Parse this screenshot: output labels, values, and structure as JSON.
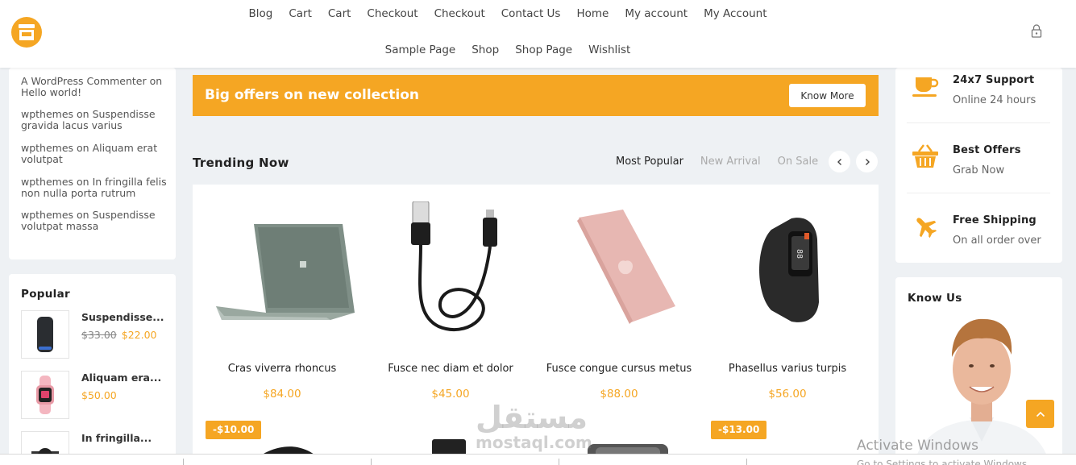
{
  "header": {
    "logo": "store-icon",
    "nav_row1": [
      "Blog",
      "Cart",
      "Cart",
      "Checkout",
      "Checkout",
      "Contact Us",
      "Home",
      "My account",
      "My Account"
    ],
    "nav_row2": [
      "Sample Page",
      "Shop",
      "Shop Page",
      "Wishlist"
    ],
    "lock_icon": "lock-icon"
  },
  "sidebar_left": {
    "comments": [
      "A WordPress Commenter on Hello world!",
      "wpthemes on Suspendisse gravida lacus varius",
      "wpthemes on Aliquam erat volutpat",
      "wpthemes on In fringilla felis non nulla porta rutrum",
      "wpthemes on Suspendisse volutpat massa"
    ],
    "popular": {
      "title": "Popular",
      "items": [
        {
          "name": "Suspendisse...",
          "old_price": "$33.00",
          "price": "$22.00"
        },
        {
          "name": "Aliquam era...",
          "old_price": "",
          "price": "$50.00"
        },
        {
          "name": "In fringilla...",
          "old_price": "",
          "price": ""
        }
      ]
    }
  },
  "banner": {
    "text": "Big offers on new collection",
    "button": "Know More"
  },
  "trending": {
    "title": "Trending Now",
    "tabs": [
      "Most Popular",
      "New Arrival",
      "On Sale"
    ],
    "active_tab": "Most Popular",
    "products": [
      {
        "name": "Cras viverra rhoncus",
        "price": "$84.00",
        "image": "laptop"
      },
      {
        "name": "Fusce nec diam et dolor",
        "price": "$45.00",
        "image": "usb-cable"
      },
      {
        "name": "Fusce congue cursus metus",
        "price": "$88.00",
        "image": "tablet"
      },
      {
        "name": "Phasellus varius turpis",
        "price": "$56.00",
        "image": "fitness-band"
      }
    ],
    "discounts": [
      "-$10.00",
      "-$13.00"
    ]
  },
  "sidebar_right": {
    "features": [
      {
        "title": "24x7 Support",
        "subtitle": "Online 24 hours",
        "icon": "cup-icon"
      },
      {
        "title": "Best Offers",
        "subtitle": "Grab Now",
        "icon": "basket-icon"
      },
      {
        "title": "Free Shipping",
        "subtitle": "On all order over",
        "icon": "plane-icon"
      }
    ],
    "know_us": {
      "title": "Know Us"
    }
  },
  "watermark": {
    "arabic": "مستقل",
    "latin": "mostaql.com"
  },
  "os_notice": {
    "line1": "Activate Windows",
    "line2": "Go to Settings to activate Windows."
  },
  "colors": {
    "accent": "#f5a623",
    "background": "#eef1f4"
  }
}
